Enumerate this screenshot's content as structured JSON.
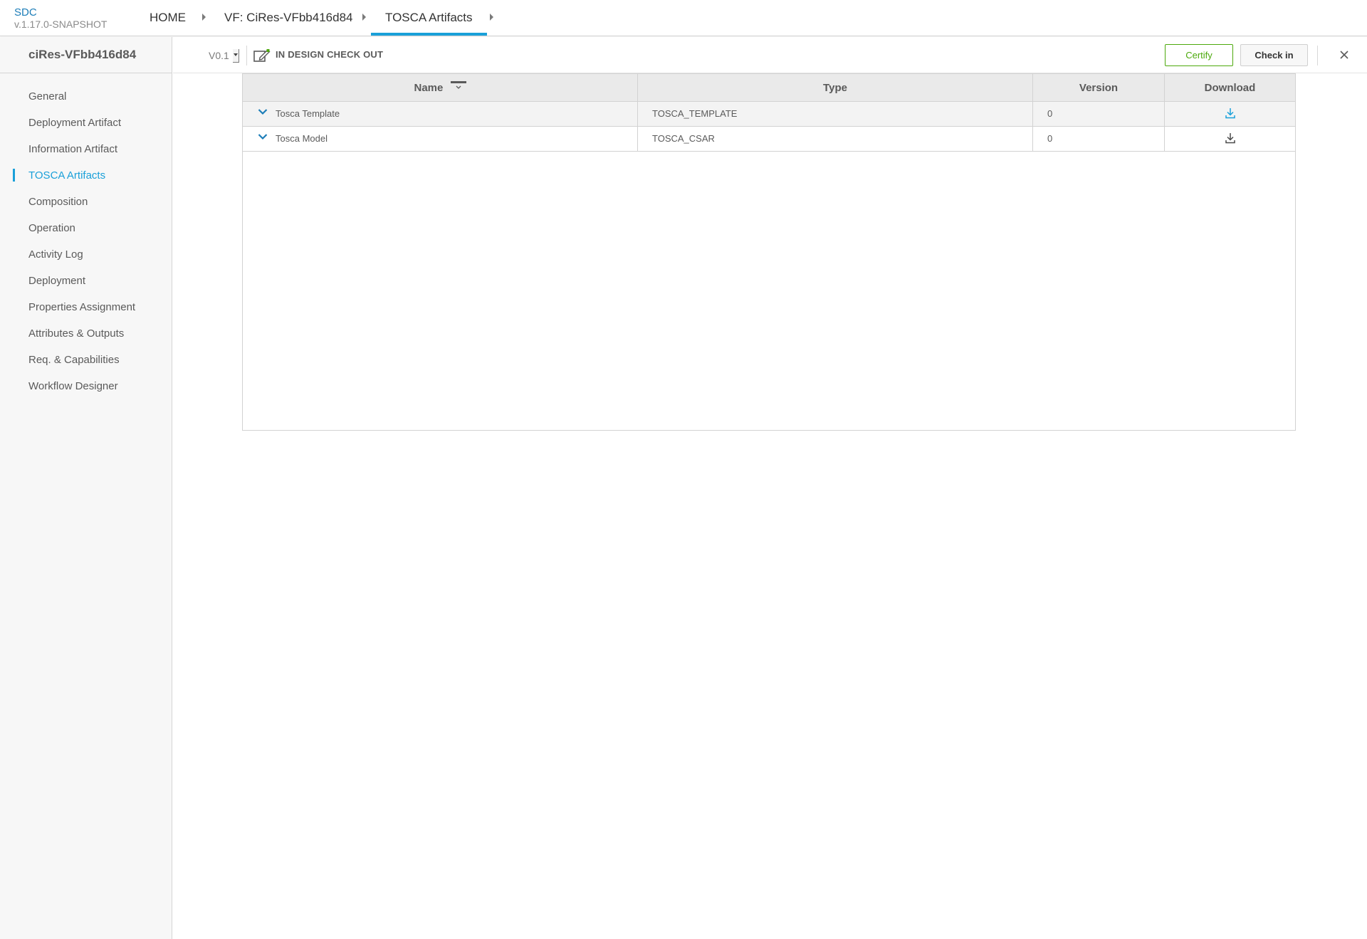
{
  "header": {
    "app_name": "SDC",
    "version": "v.1.17.0-SNAPSHOT",
    "breadcrumbs": [
      {
        "label": "HOME"
      },
      {
        "label": "VF: CiRes-VFbb416d84"
      },
      {
        "label": "TOSCA Artifacts"
      }
    ]
  },
  "sidebar": {
    "title": "ciRes-VFbb416d84",
    "items": [
      {
        "label": "General"
      },
      {
        "label": "Deployment Artifact"
      },
      {
        "label": "Information Artifact"
      },
      {
        "label": "TOSCA Artifacts",
        "active": true
      },
      {
        "label": "Composition"
      },
      {
        "label": "Operation"
      },
      {
        "label": "Activity Log"
      },
      {
        "label": "Deployment"
      },
      {
        "label": "Properties Assignment"
      },
      {
        "label": "Attributes & Outputs"
      },
      {
        "label": "Req. & Capabilities"
      },
      {
        "label": "Workflow Designer"
      }
    ]
  },
  "workspace": {
    "version_value": "V0.1",
    "status": "IN DESIGN CHECK OUT",
    "certify_label": "Certify",
    "checkin_label": "Check in",
    "close_icon": "close-icon",
    "accent_color": "#1aa0d9",
    "certify_color": "#4ca90c"
  },
  "table": {
    "columns": [
      "Name",
      "Type",
      "Version",
      "Download"
    ],
    "rows": [
      {
        "name": "Tosca Template",
        "type": "TOSCA_TEMPLATE",
        "version": "0",
        "download_icon": "download-icon",
        "highlight": true
      },
      {
        "name": "Tosca Model",
        "type": "TOSCA_CSAR",
        "version": "0",
        "download_icon": "download-icon",
        "highlight": false
      }
    ]
  }
}
